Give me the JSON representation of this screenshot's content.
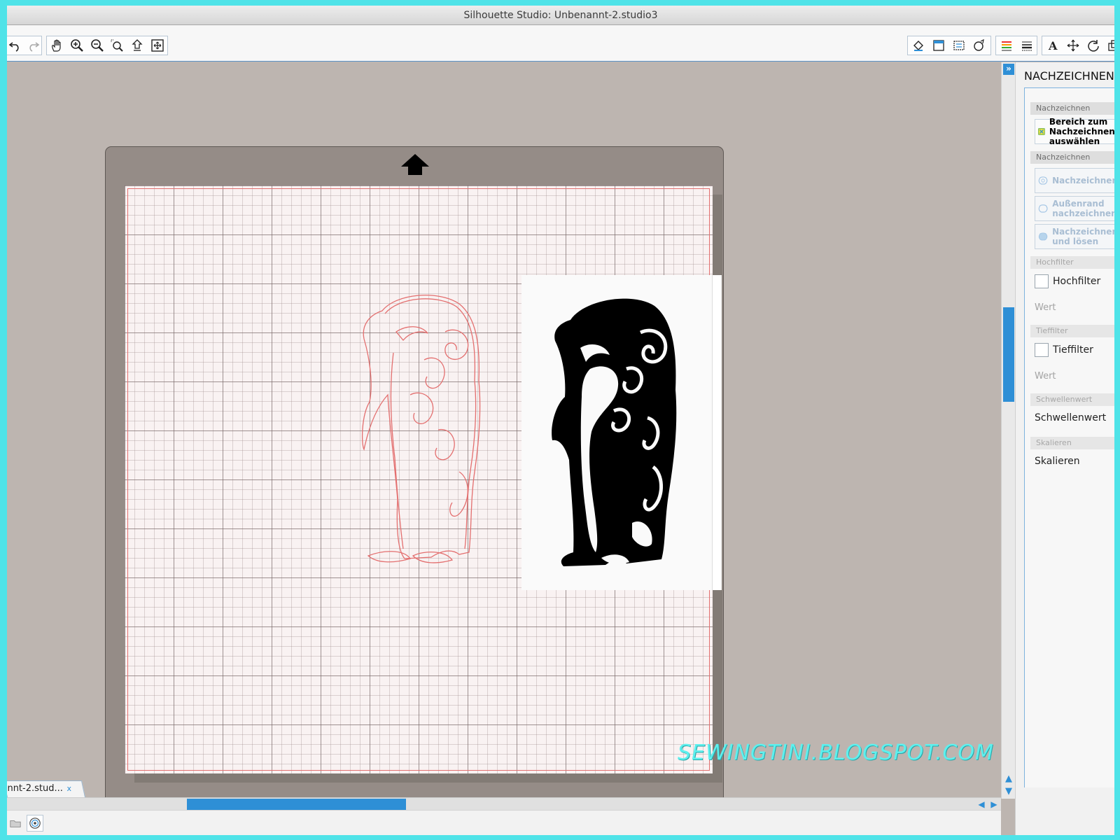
{
  "window": {
    "title": "Silhouette Studio: Unbenannt-2.studio3"
  },
  "toolbar": {
    "left_tools": [
      "undo-icon",
      "redo-icon",
      "hand-pan-icon",
      "zoom-in-icon",
      "zoom-out-icon",
      "zoom-select-icon",
      "drag-zoom-icon",
      "fit-to-page-icon"
    ],
    "right_tools": [
      "fill-bucket-icon",
      "page-setup-icon",
      "cut-settings-icon",
      "pen-shape-icon",
      "line-color-icon",
      "line-style-icon",
      "text-icon",
      "pin-align-icon",
      "rotate-icon",
      "transform-icon"
    ]
  },
  "panel": {
    "title": "NACHZEICHNEN",
    "section_trace_area": "Nachzeichnen",
    "select_area_button": "Bereich zum Nachzeichnen auswählen",
    "section_trace": "Nachzeichnen",
    "trace_button": "Nachzeichnen",
    "outer_edge_button": "Außenrand nachzeichnen",
    "trace_detach_button": "Nachzeichnen und lösen",
    "section_high_pass": "Hochfilter",
    "high_pass_checkbox": "Hochfilter",
    "high_pass_value_label": "Wert",
    "section_low_pass": "Tieffilter",
    "low_pass_checkbox": "Tieffilter",
    "low_pass_value_label": "Wert",
    "section_threshold": "Schwellenwert",
    "threshold_label": "Schwellenwert",
    "section_scale": "Skalieren",
    "scale_label": "Skalieren"
  },
  "document_tab": {
    "label": "nnt-2.stud...",
    "close": "x"
  },
  "watermark": "SEWINGTINI.BLOGSPOT.COM",
  "colors": {
    "accent_blue": "#2e8fd6",
    "trace_line_red": "#e36f6f",
    "mat_gray": "#958c87",
    "background_cyan": "#4fe3e8"
  }
}
